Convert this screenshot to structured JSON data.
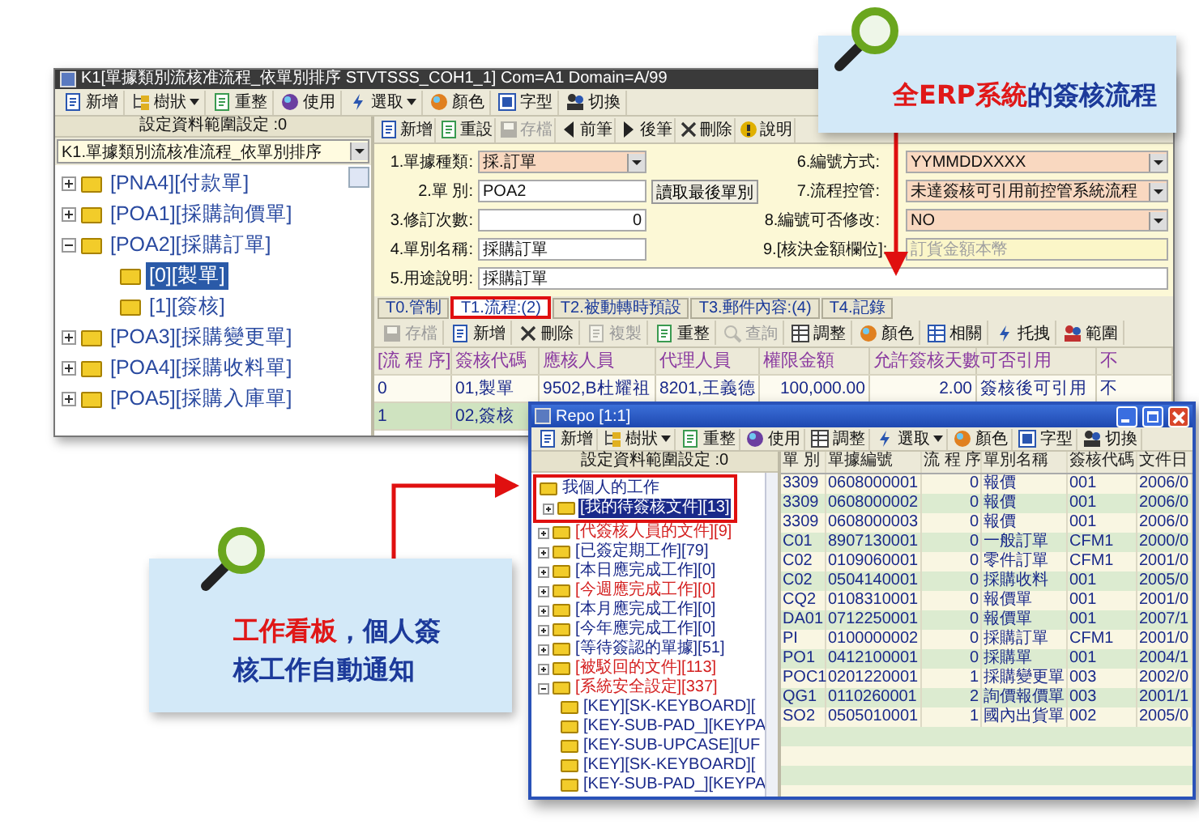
{
  "main_window": {
    "title": "K1[單據類別流核准流程_依單別排序 STVTSSS_COH1_1] Com=A1 Domain=A/99",
    "toolbar": [
      {
        "kind": "new",
        "label": "新增",
        "dropdown": false
      },
      {
        "kind": "tree",
        "label": "樹狀",
        "dropdown": true
      },
      {
        "kind": "refresh",
        "label": "重整",
        "dropdown": false
      },
      {
        "kind": "use",
        "label": "使用",
        "dropdown": false
      },
      {
        "kind": "select",
        "label": "選取",
        "dropdown": true
      },
      {
        "kind": "color",
        "label": "顏色",
        "dropdown": false
      },
      {
        "kind": "font",
        "label": "字型",
        "dropdown": false
      },
      {
        "kind": "switch",
        "label": "切換",
        "dropdown": false
      }
    ],
    "left_panel": {
      "header": "設定資料範圍設定 :0",
      "dropdown": "K1.單據類別流核准流程_依單別排序",
      "tree": [
        {
          "label": "[PNA4][付款單]",
          "expanded": false,
          "selected": false
        },
        {
          "label": "[POA1][採購詢價單]",
          "expanded": false,
          "selected": false
        },
        {
          "label": "[POA2][採購訂單]",
          "expanded": true,
          "selected": false,
          "children": [
            {
              "label": "[0][製單]",
              "selected": true
            },
            {
              "label": "[1][簽核]",
              "selected": false
            }
          ]
        },
        {
          "label": "[POA3][採購變更單]",
          "expanded": false,
          "selected": false
        },
        {
          "label": "[POA4][採購收料單]",
          "expanded": false,
          "selected": false
        },
        {
          "label": "[POA5][採購入庫單]",
          "expanded": false,
          "selected": false
        }
      ]
    },
    "detail": {
      "toolbar": [
        {
          "kind": "new",
          "label": "新增",
          "disabled": false
        },
        {
          "kind": "reset",
          "label": "重設",
          "disabled": false
        },
        {
          "kind": "save",
          "label": "存檔",
          "disabled": true
        },
        {
          "kind": "prev",
          "label": "前筆",
          "disabled": false
        },
        {
          "kind": "next",
          "label": "後筆",
          "disabled": false
        },
        {
          "kind": "delete",
          "label": "刪除",
          "disabled": false
        },
        {
          "kind": "help",
          "label": "說明",
          "disabled": false
        }
      ],
      "form": [
        {
          "left": {
            "label": "1.單據種類:",
            "value": "採.訂單",
            "kind": "select"
          },
          "right": {
            "label": "6.編號方式:",
            "value": "YYMMDDXXXX",
            "kind": "select"
          }
        },
        {
          "left": {
            "label": "2.單 別:",
            "value": "POA2",
            "kind": "text",
            "button": "讀取最後單別"
          },
          "right": {
            "label": "7.流程控管:",
            "value": "未達簽核可引用前控管系統流程",
            "kind": "select"
          }
        },
        {
          "left": {
            "label": "3.修訂次數:",
            "value": "0",
            "kind": "number"
          },
          "right": {
            "label": "8.編號可否修改:",
            "value": "NO",
            "kind": "select"
          }
        },
        {
          "left": {
            "label": "4.單別名稱:",
            "value": "採購訂單",
            "kind": "text"
          },
          "right": {
            "label": "9.[核決金額欄位]:",
            "placeholder": "訂貨金額本幣",
            "kind": "readonly"
          }
        },
        {
          "left": {
            "label": "5.用途說明:",
            "value": "採購訂單",
            "kind": "wide"
          }
        }
      ],
      "tabs": [
        {
          "label": "T0.管制",
          "selected": false
        },
        {
          "label": "T1.流程:(2)",
          "selected": true
        },
        {
          "label": "T2.被動轉時預設",
          "selected": false
        },
        {
          "label": "T3.郵件內容:(4)",
          "selected": false
        },
        {
          "label": "T4.記錄",
          "selected": false
        }
      ],
      "grid_toolbar": [
        {
          "kind": "save",
          "label": "存檔",
          "disabled": true
        },
        {
          "kind": "new",
          "label": "新增",
          "disabled": false
        },
        {
          "kind": "delete",
          "label": "刪除",
          "disabled": false
        },
        {
          "kind": "copy",
          "label": "複製",
          "disabled": true
        },
        {
          "kind": "refresh",
          "label": "重整",
          "disabled": false
        },
        {
          "kind": "query",
          "label": "查詢",
          "disabled": true
        },
        {
          "kind": "adjust",
          "label": "調整",
          "disabled": false
        },
        {
          "kind": "color",
          "label": "顏色",
          "disabled": false
        },
        {
          "kind": "related",
          "label": "相關",
          "disabled": false
        },
        {
          "kind": "drag",
          "label": "托拽",
          "disabled": false
        },
        {
          "kind": "range",
          "label": "範圍",
          "disabled": false
        }
      ],
      "grid": {
        "columns": [
          "[流 程 序]",
          "簽核代碼",
          "應核人員",
          "代理人員",
          "權限金額",
          "允許簽核天數",
          "可否引用",
          "不"
        ],
        "rows": [
          {
            "selected": false,
            "cells": [
              "0",
              "01,製單",
              "9502,B杜耀祖",
              "8201,王義德",
              "100,000.00",
              "2.00",
              "簽核後可引用",
              "不"
            ]
          },
          {
            "selected": true,
            "cells": [
              "1",
              "02,簽核"
            ]
          }
        ]
      }
    }
  },
  "report_window": {
    "title": "Repo [1:1]",
    "toolbar": [
      {
        "kind": "new",
        "label": "新增",
        "dropdown": false
      },
      {
        "kind": "tree",
        "label": "樹狀",
        "dropdown": true
      },
      {
        "kind": "refresh",
        "label": "重整",
        "dropdown": false
      },
      {
        "kind": "use",
        "label": "使用",
        "dropdown": false
      },
      {
        "kind": "adjust",
        "label": "調整",
        "dropdown": false
      },
      {
        "kind": "select",
        "label": "選取",
        "dropdown": true
      },
      {
        "kind": "color",
        "label": "顏色",
        "dropdown": false
      },
      {
        "kind": "font",
        "label": "字型",
        "dropdown": false
      },
      {
        "kind": "switch",
        "label": "切換",
        "dropdown": false
      }
    ],
    "tree_header": "設定資料範圍設定 :0",
    "tree": {
      "label": "我個人的工作",
      "children": [
        {
          "label": "[我的待簽核文件][13]",
          "expanded": false,
          "selected": true,
          "color": "#1a2a8a"
        },
        {
          "label": "[代簽核人員的文件][9]",
          "expanded": false,
          "selected": false,
          "color": "#d42020"
        },
        {
          "label": "[已簽定期工作][79]",
          "expanded": false,
          "selected": false,
          "color": "#1a2a8a"
        },
        {
          "label": "[本日應完成工作][0]",
          "expanded": false,
          "selected": false,
          "color": "#1a2a8a"
        },
        {
          "label": "[今週應完成工作][0]",
          "expanded": false,
          "selected": false,
          "color": "#d42020"
        },
        {
          "label": "[本月應完成工作][0]",
          "expanded": false,
          "selected": false,
          "color": "#1a2a8a"
        },
        {
          "label": "[今年應完成工作][0]",
          "expanded": false,
          "selected": false,
          "color": "#1a2a8a"
        },
        {
          "label": "[等待簽認的單據][51]",
          "expanded": false,
          "selected": false,
          "color": "#1a2a8a"
        },
        {
          "label": "[被駁回的文件][113]",
          "expanded": false,
          "selected": false,
          "color": "#d42020"
        },
        {
          "label": "[系統安全設定][337]",
          "expanded": true,
          "selected": false,
          "color": "#d42020",
          "children": [
            {
              "label": "[KEY][SK-KEYBOARD]["
            },
            {
              "label": "[KEY-SUB-PAD_][KEYPA"
            },
            {
              "label": "[KEY-SUB-UPCASE][UF"
            },
            {
              "label": "[KEY][SK-KEYBOARD]["
            },
            {
              "label": "[KEY-SUB-PAD_][KEYPA"
            }
          ]
        }
      ]
    },
    "grid": {
      "columns": [
        "單 別",
        "單據編號",
        "流 程 序",
        "單別名稱",
        "簽核代碼",
        "文件日"
      ],
      "rows": [
        [
          "3309",
          "0608000001",
          "0",
          "報價",
          "001",
          "2006/0"
        ],
        [
          "3309",
          "0608000002",
          "0",
          "報價",
          "001",
          "2006/0"
        ],
        [
          "3309",
          "0608000003",
          "0",
          "報價",
          "001",
          "2006/0"
        ],
        [
          "C01",
          "8907130001",
          "0",
          "一般訂單",
          "CFM1",
          "2000/0"
        ],
        [
          "C02",
          "0109060001",
          "0",
          "零件訂單",
          "CFM1",
          "2001/0"
        ],
        [
          "C02",
          "0504140001",
          "0",
          "採購收料",
          "001",
          "2005/0"
        ],
        [
          "CQ2",
          "0108310001",
          "0",
          "報價單",
          "001",
          "2001/0"
        ],
        [
          "DA01",
          "0712250001",
          "0",
          "報價單",
          "001",
          "2007/1"
        ],
        [
          "PI",
          "0100000002",
          "0",
          "採購訂單",
          "CFM1",
          "2001/0"
        ],
        [
          "PO1",
          "0412100001",
          "0",
          "採購單",
          "001",
          "2004/1"
        ],
        [
          "POC1",
          "0201220001",
          "1",
          "採購變更單",
          "003",
          "2002/0"
        ],
        [
          "QG1",
          "0110260001",
          "2",
          "詢價報價單",
          "003",
          "2001/1"
        ],
        [
          "SO2",
          "0505010001",
          "1",
          "國內出貨單",
          "002",
          "2005/0"
        ]
      ]
    }
  },
  "top_callout": {
    "highlight": "全ERP系統",
    "text": "的簽核流程"
  },
  "bottom_callout": {
    "highlight": "工作看板",
    "text": "，個人簽核工作自動通知"
  }
}
